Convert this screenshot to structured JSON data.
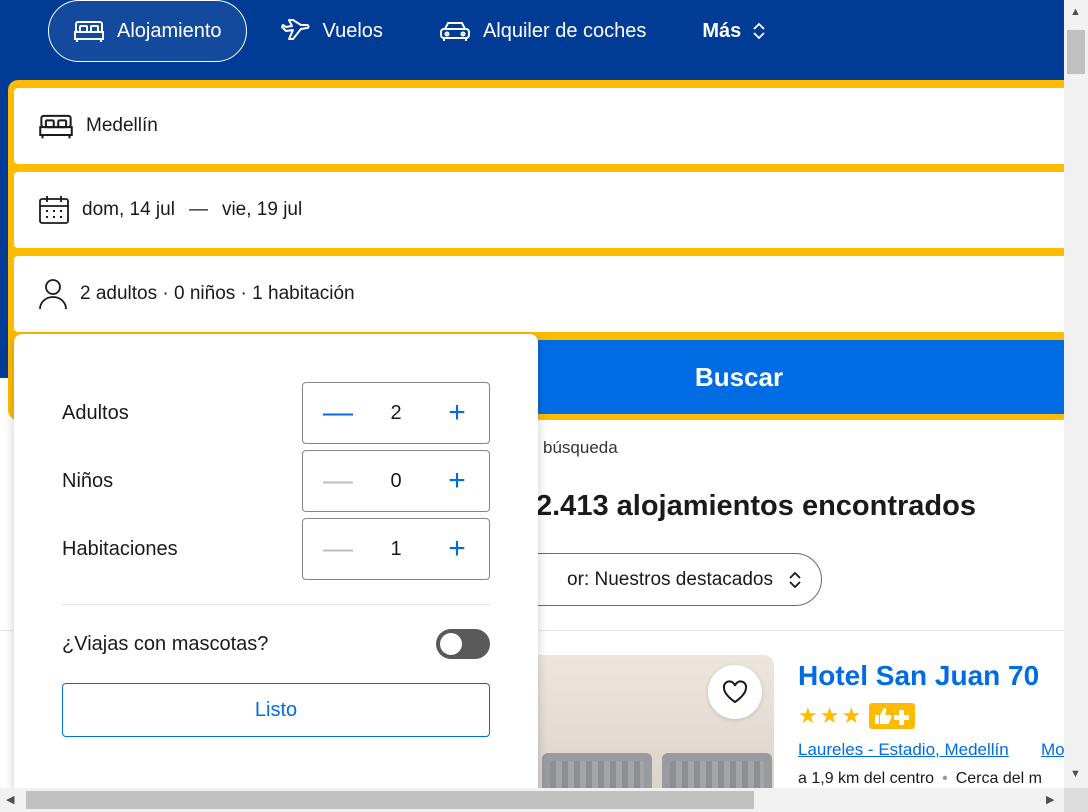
{
  "nav": {
    "items": [
      {
        "label": "Alojamiento",
        "icon": "bed-icon",
        "active": true
      },
      {
        "label": "Vuelos",
        "icon": "plane-icon",
        "active": false
      },
      {
        "label": "Alquiler de coches",
        "icon": "car-icon",
        "active": false
      }
    ],
    "more_label": "Más",
    "more_icon": "chevron-updown-icon"
  },
  "search": {
    "destination": "Medellín",
    "checkin": "dom, 14 jul",
    "dash": "—",
    "checkout": "vie, 19 jul",
    "occupancy": "2 adultos · 0 niños · 1 habitación",
    "submit_label": "Buscar"
  },
  "results": {
    "hint": "búsqueda",
    "count_text": "2.413 alojamientos encontrados",
    "sort_label": "or: Nuestros destacados"
  },
  "hotel": {
    "name": "Hotel San Juan 70",
    "stars": 3,
    "location": "Laureles - Estadio, Medellín",
    "location_extra": "Mo",
    "distance": "a 1,9 km del centro",
    "nearby": "Cerca del m"
  },
  "occupancy_popup": {
    "rows": [
      {
        "label": "Adultos",
        "value": "2",
        "minus_enabled": true
      },
      {
        "label": "Niños",
        "value": "0",
        "minus_enabled": false
      },
      {
        "label": "Habitaciones",
        "value": "1",
        "minus_enabled": false
      }
    ],
    "minus": "—",
    "plus": "+",
    "pets_label": "¿Viajas con mascotas?",
    "pets_enabled": false,
    "done_label": "Listo"
  },
  "scrollbars": {
    "up": "▲",
    "down": "▼",
    "left": "◀",
    "right": "▶"
  },
  "colors": {
    "brand_blue": "#003b95",
    "accent_blue": "#006ce4",
    "search_yellow": "#febb02"
  }
}
